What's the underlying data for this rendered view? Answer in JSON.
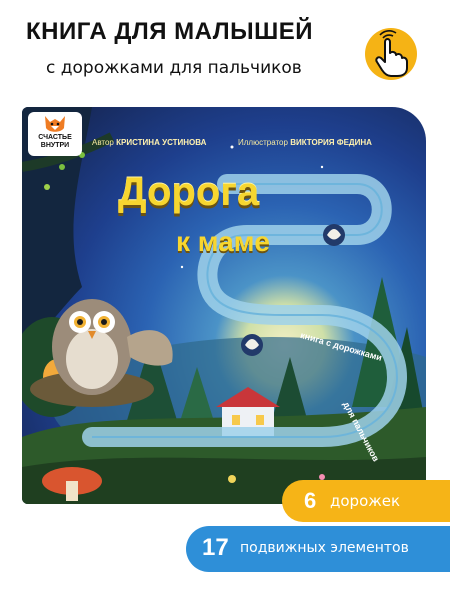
{
  "header": {
    "title": "КНИГА ДЛЯ МАЛЫШЕЙ",
    "subtitle": "с дорожками для пальчиков"
  },
  "icons": {
    "finger": "pointing-finger-icon"
  },
  "colors": {
    "accent_yellow": "#f6b417",
    "accent_blue": "#2e8fd8",
    "title_yellow": "#f7d630"
  },
  "book": {
    "publisher": "СЧАСТЬЕ ВНУТРИ",
    "author_label": "Автор",
    "author_name": "КРИСТИНА УСТИНОВА",
    "illustrator_label": "Иллюстратор",
    "illustrator_name": "ВИКТОРИЯ ФЕДИНА",
    "title": "Дорога",
    "title_line2": "к маме",
    "tagline_part1": "книга с дорожками",
    "tagline_part2": "для пальчиков"
  },
  "badges": {
    "paths_count": "6",
    "paths_label": "дорожек",
    "elements_count": "17",
    "elements_label": "подвижных элементов"
  }
}
